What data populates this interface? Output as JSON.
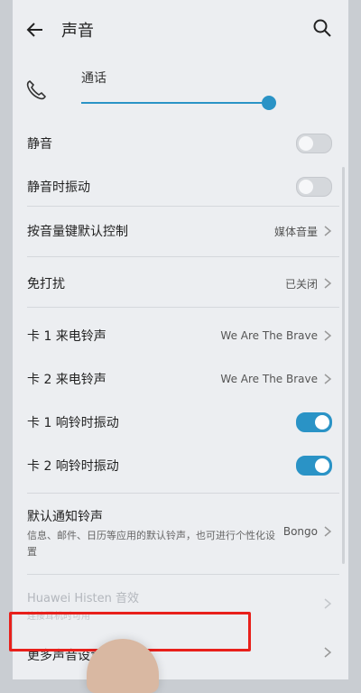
{
  "header": {
    "title": "声音"
  },
  "volume": {
    "label": "通话",
    "level": 0.95
  },
  "items": [
    {
      "label": "静音"
    },
    {
      "label": "静音时振动"
    },
    {
      "label": "按音量键默认控制",
      "value": "媒体音量"
    },
    {
      "label": "免打扰",
      "value": "已关闭"
    },
    {
      "label": "卡 1 来电铃声",
      "value": "We Are The Brave"
    },
    {
      "label": "卡 2 来电铃声",
      "value": "We Are The Brave"
    },
    {
      "label": "卡 1 响铃时振动"
    },
    {
      "label": "卡 2 响铃时振动"
    }
  ],
  "toggles": {
    "mute": false,
    "vibrate_on_mute": false,
    "card1_vibrate": true,
    "card2_vibrate": true
  },
  "notification": {
    "title": "默认通知铃声",
    "description": "信息、邮件、日历等应用的默认铃声，也可进行个性化设置",
    "value": "Bongo"
  },
  "histen": {
    "title": "Huawei Histen 音效",
    "subtitle": "连接耳机时可用"
  },
  "more": {
    "title": "更多声音设置"
  },
  "colors": {
    "accent": "#2a93c6",
    "highlight": "#e8201b"
  }
}
